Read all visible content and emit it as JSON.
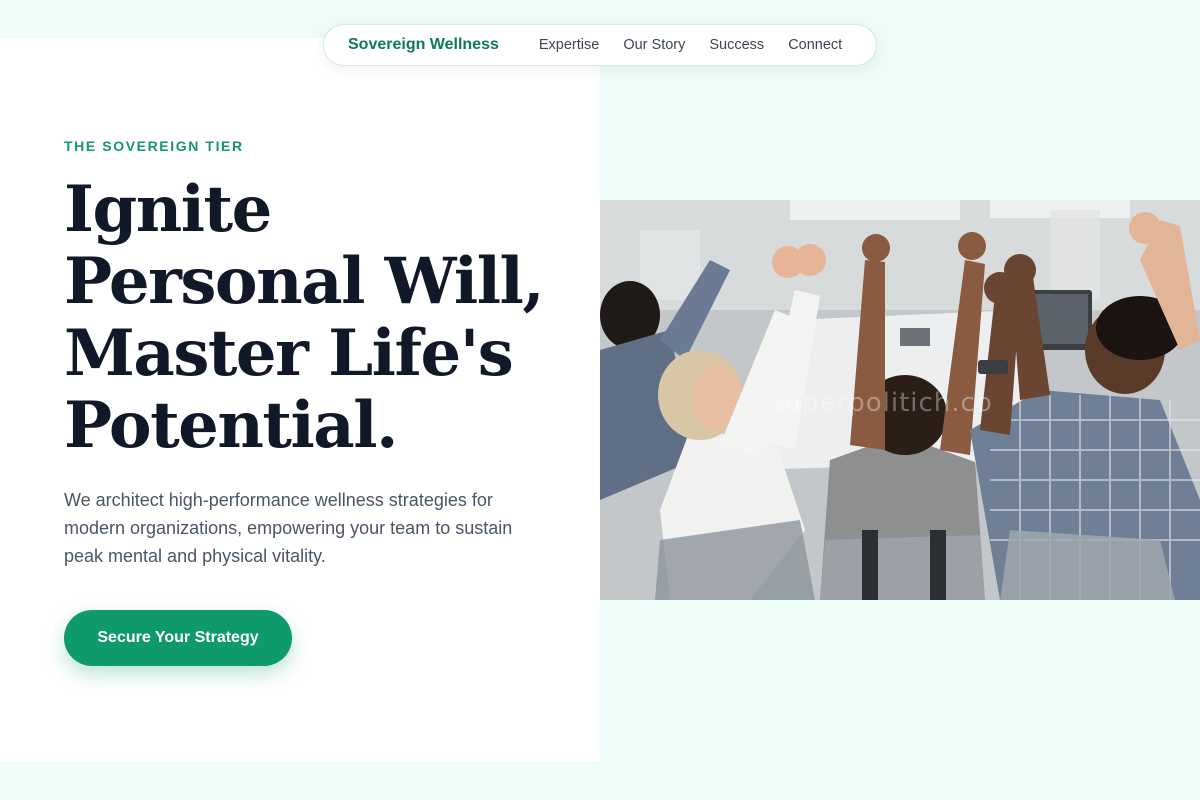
{
  "nav": {
    "brand": "Sovereign Wellness",
    "links": [
      "Expertise",
      "Our Story",
      "Success",
      "Connect"
    ]
  },
  "hero": {
    "eyebrow": "THE SOVEREIGN TIER",
    "headline_lines": [
      "Ignite",
      "Personal Will,",
      "Master Life's",
      "Potential."
    ],
    "subcopy": "We architect high-performance wellness strategies for modern organizations, empowering your team to sustain peak mental and physical vitality.",
    "cta_label": "Secure Your Strategy"
  },
  "photo": {
    "watermark": "superpolitich.co"
  },
  "colors": {
    "brand_green": "#0f7a57",
    "cta_green": "#0e9a6c",
    "page_background": "#eefcf7",
    "headline_dark": "#111827"
  }
}
